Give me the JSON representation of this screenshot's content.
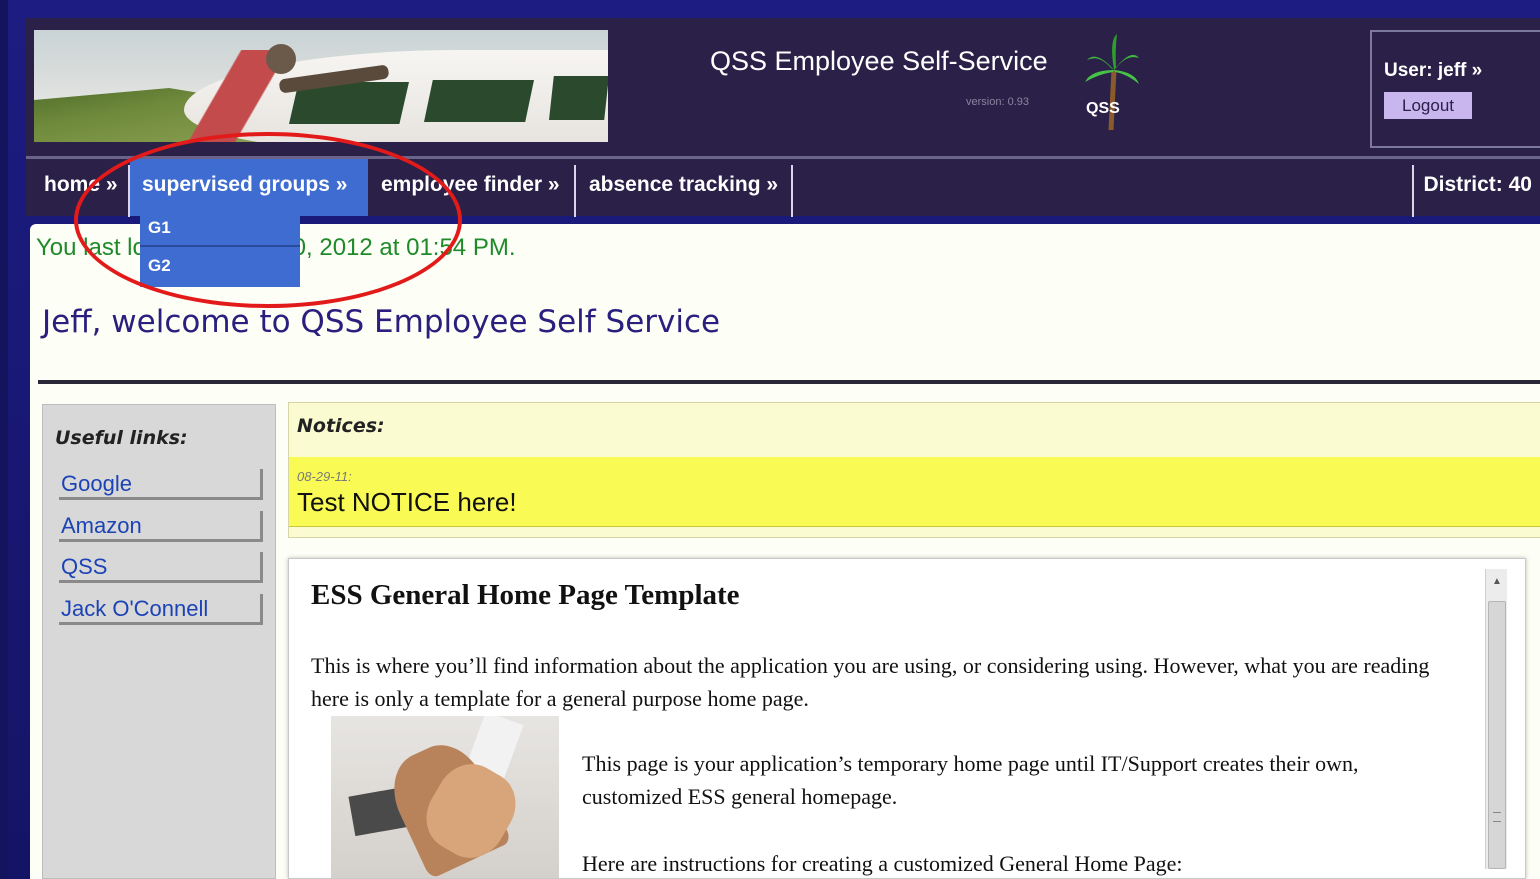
{
  "header": {
    "app_title": "QSS Employee Self-Service",
    "version": "version: 0.93",
    "logo_text": "QSS",
    "user_label": "User: jeff »",
    "logout_label": "Logout"
  },
  "nav": {
    "home": "home »",
    "supervised_groups": "supervised groups »",
    "employee_finder": "employee finder »",
    "absence_tracking": "absence tracking »",
    "district": "District: 40"
  },
  "dropdown": {
    "items": [
      "G1",
      "G2"
    ]
  },
  "content": {
    "last_login": "You last logged in Aug 20, 2012 at 01:54 PM.",
    "welcome": "Jeff, welcome to QSS Employee Self Service"
  },
  "useful_links": {
    "title": "Useful links:",
    "items": [
      "Google",
      "Amazon",
      "QSS",
      "Jack O'Connell"
    ]
  },
  "notices": {
    "title": "Notices:",
    "date": "08-29-11:",
    "text": "Test NOTICE here!"
  },
  "template": {
    "heading": "ESS General Home Page Template",
    "para1": "This is where you’ll find information about the application you are using, or considering using. However, what you are reading here is only a template for a general purpose home page.",
    "para2": "This page is your application’s temporary home page until IT/Support creates their own, customized ESS general homepage.",
    "para3": "Here are instructions for creating a customized General Home Page:"
  },
  "colors": {
    "header_bg": "#2a2048",
    "nav_active": "#3f6cd0",
    "highlight_ellipse": "#e21a1a",
    "notice_yellow": "#fafa55"
  }
}
